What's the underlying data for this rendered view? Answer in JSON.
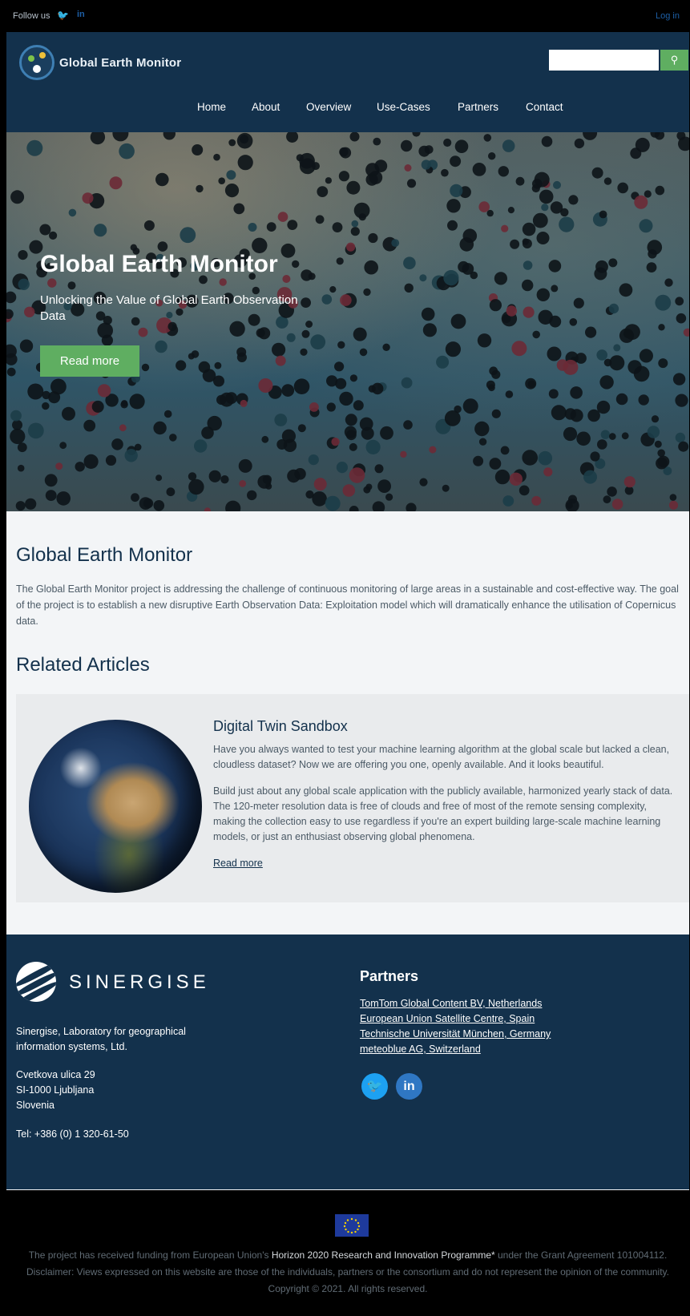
{
  "topbar": {
    "follow_label": "Follow us",
    "twitter_icon": "twitter-icon",
    "linkedin_icon": "linkedin-icon",
    "linkedin_glyph": "in",
    "login_label": "Log in"
  },
  "header": {
    "logo_text": "Global Earth Monitor",
    "search_placeholder": "",
    "search_icon": "search-icon"
  },
  "nav": {
    "items": [
      {
        "label": "Home"
      },
      {
        "label": "About"
      },
      {
        "label": "Overview"
      },
      {
        "label": "Use-Cases"
      },
      {
        "label": "Partners"
      },
      {
        "label": "Contact"
      }
    ]
  },
  "hero": {
    "title": "Global Earth Monitor",
    "subtitle": "Unlocking the Value of Global Earth Observation Data",
    "button_label": "Read more"
  },
  "about": {
    "title": "Global Earth Monitor",
    "text": "The Global Earth Monitor project is addressing the challenge of continuous monitoring of large areas in a sustainable and cost-effective way. The goal of the project is to establish a new disruptive Earth Observation Data: Exploitation model which will dramatically enhance the utilisation of Copernicus data."
  },
  "related": {
    "title": "Related Articles",
    "article": {
      "title": "Digital Twin Sandbox",
      "p1": "Have you always wanted to test your machine learning algorithm at the global scale but lacked a clean, cloudless dataset? Now we are offering you one, openly available. And it looks beautiful.",
      "p2": "Build just about any global scale application with the publicly available, harmonized yearly stack of data. The 120-meter resolution data is free of clouds and free of most of the remote sensing complexity, making the collection easy to use regardless if you're an expert building large-scale machine learning models, or just an enthusiast observing global phenomena.",
      "read_more": "Read more"
    }
  },
  "footer": {
    "company_name": "SINERGISE",
    "company_line1": "Sinergise, Laboratory for geographical",
    "company_line2": "information systems, Ltd.",
    "address1": "Cvetkova ulica 29",
    "address2": "SI-1000 Ljubljana",
    "address3": "Slovenia",
    "tel": "Tel: +386 (0) 1 320-61-50",
    "partners_title": "Partners",
    "partners": [
      "TomTom Global Content BV, Netherlands",
      "European Union Satellite Centre, Spain",
      "Technische Universität München, Germany",
      "meteoblue AG, Switzerland"
    ],
    "twitter_glyph": "🐦",
    "linkedin_glyph": "in"
  },
  "bottom": {
    "funding_prefix": "The project has received funding from European Union's ",
    "funding_highlight": "Horizon 2020 Research and Innovation Programme*",
    "funding_suffix": " under the Grant Agreement 101004112.",
    "disclaimer": "Disclaimer: Views expressed on this website are those of the individuals, partners or the consortium and do not represent the opinion of the community.",
    "copyright": "Copyright © 2021. All rights reserved."
  },
  "colors": {
    "header_bg": "#13314c",
    "accent_green": "#5fae61",
    "footer_bg": "#13314c"
  }
}
